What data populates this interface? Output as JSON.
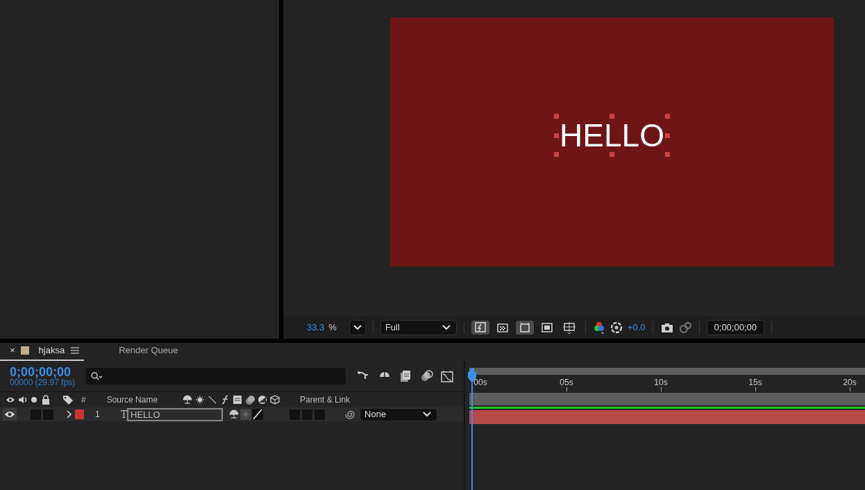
{
  "viewer": {
    "canvas_text": "HELLO",
    "zoom": "33.3",
    "zoom_unit": "%",
    "resolution": "Full",
    "exposure": "+0.0",
    "timecode": "0;00;00;00",
    "toggles": [
      {
        "kind": "fast-previews",
        "on": true
      },
      {
        "kind": "transparency-grid",
        "on": false
      },
      {
        "kind": "region-of-interest",
        "on": true
      },
      {
        "kind": "mask",
        "on": false
      },
      {
        "kind": "guides",
        "on": false
      }
    ]
  },
  "timeline": {
    "tabs": [
      {
        "close": "×",
        "label": "hjaksa",
        "selected": true,
        "color": "#bfae8c"
      },
      {
        "label": "Render Queue",
        "selected": false
      }
    ],
    "timecode": "0;00;00;00",
    "frames": "00000 (29.97 fps)",
    "columns": {
      "number": "#",
      "source_name": "Source Name",
      "parent": "Parent & Link"
    },
    "ruler": [
      "00s",
      "05s",
      "10s",
      "15s",
      "20s"
    ],
    "layers": [
      {
        "visible": true,
        "expanded": false,
        "color": "#c83434",
        "number": "1",
        "type_glyph": "T",
        "name": "HELLO",
        "parent": "None"
      }
    ]
  }
}
